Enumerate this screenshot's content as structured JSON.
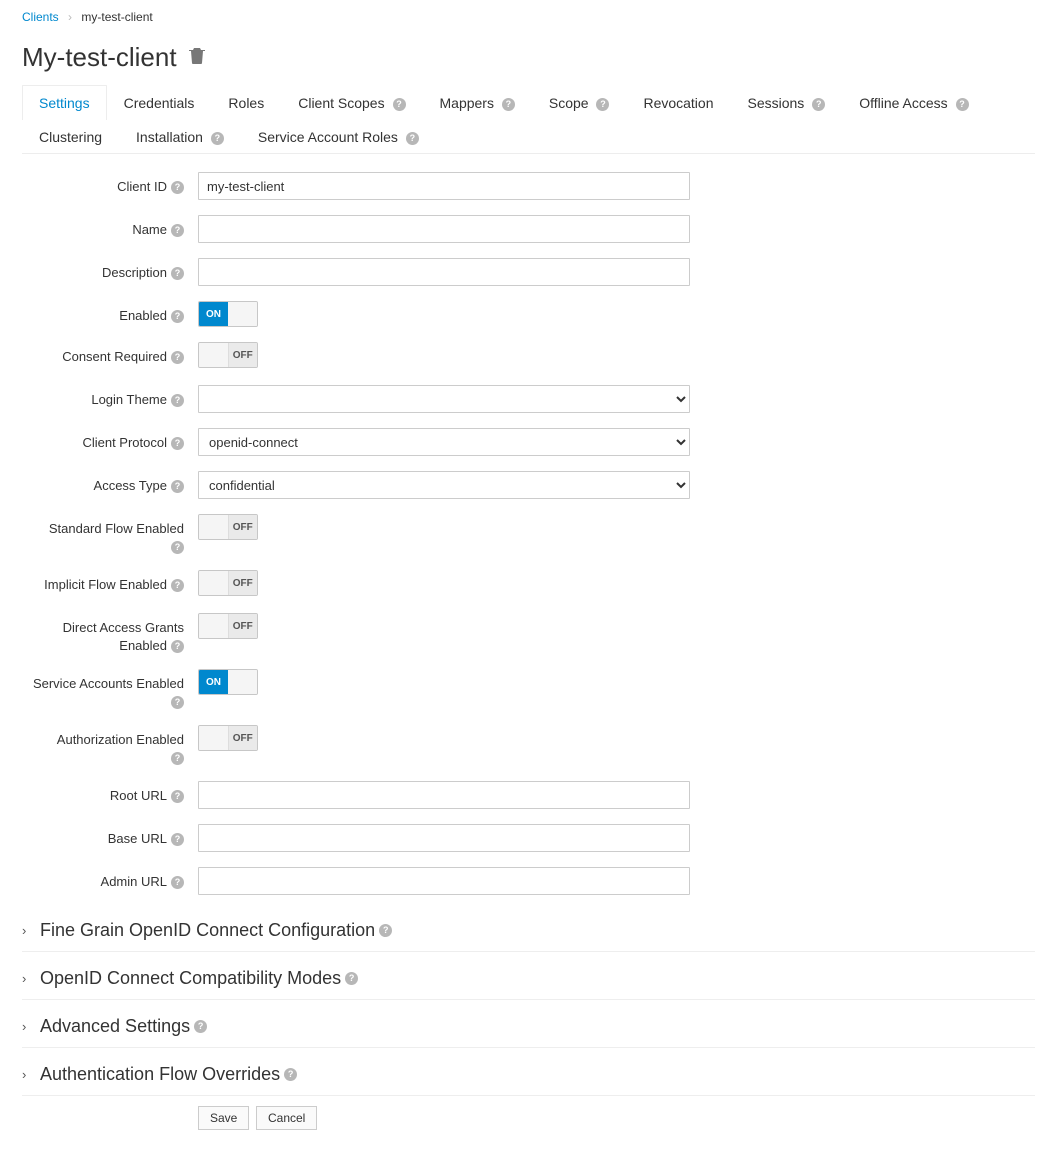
{
  "breadcrumb": {
    "parent": "Clients",
    "current": "my-test-client"
  },
  "page_title": "My-test-client",
  "tabs": [
    {
      "label": "Settings",
      "help": false,
      "active": true
    },
    {
      "label": "Credentials",
      "help": false
    },
    {
      "label": "Roles",
      "help": false
    },
    {
      "label": "Client Scopes",
      "help": true
    },
    {
      "label": "Mappers",
      "help": true
    },
    {
      "label": "Scope",
      "help": true
    },
    {
      "label": "Revocation",
      "help": false
    },
    {
      "label": "Sessions",
      "help": true
    },
    {
      "label": "Offline Access",
      "help": true
    },
    {
      "label": "Clustering",
      "help": false
    },
    {
      "label": "Installation",
      "help": true
    },
    {
      "label": "Service Account Roles",
      "help": true
    }
  ],
  "fields": {
    "client_id": {
      "label": "Client ID",
      "value": "my-test-client"
    },
    "name": {
      "label": "Name",
      "value": ""
    },
    "description": {
      "label": "Description",
      "value": ""
    },
    "enabled": {
      "label": "Enabled",
      "on": true
    },
    "consent_required": {
      "label": "Consent Required",
      "on": false
    },
    "login_theme": {
      "label": "Login Theme",
      "value": ""
    },
    "client_protocol": {
      "label": "Client Protocol",
      "value": "openid-connect"
    },
    "access_type": {
      "label": "Access Type",
      "value": "confidential"
    },
    "standard_flow": {
      "label": "Standard Flow Enabled",
      "on": false
    },
    "implicit_flow": {
      "label": "Implicit Flow Enabled",
      "on": false
    },
    "direct_access": {
      "label": "Direct Access Grants Enabled",
      "on": false
    },
    "service_accounts": {
      "label": "Service Accounts Enabled",
      "on": true
    },
    "authorization": {
      "label": "Authorization Enabled",
      "on": false
    },
    "root_url": {
      "label": "Root URL",
      "value": ""
    },
    "base_url": {
      "label": "Base URL",
      "value": ""
    },
    "admin_url": {
      "label": "Admin URL",
      "value": ""
    }
  },
  "toggle_labels": {
    "on": "ON",
    "off": "OFF"
  },
  "sections": [
    "Fine Grain OpenID Connect Configuration",
    "OpenID Connect Compatibility Modes",
    "Advanced Settings",
    "Authentication Flow Overrides"
  ],
  "buttons": {
    "save": "Save",
    "cancel": "Cancel"
  }
}
